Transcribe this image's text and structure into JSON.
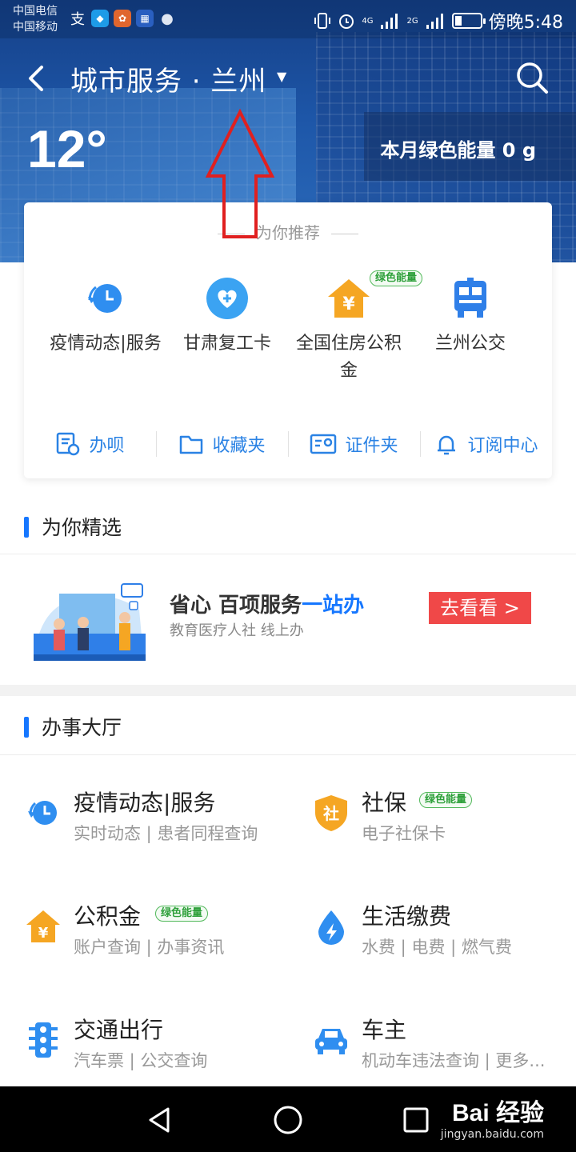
{
  "status_bar": {
    "carrier_1": "中国电信",
    "carrier_2": "中国移动",
    "network_1": "4G",
    "network_2": "2G",
    "battery_level": 0.25,
    "time": "傍晚5:48"
  },
  "header": {
    "title": "城市服务 · 兰州",
    "temperature": "12°",
    "energy_label": "本月绿色能量",
    "energy_value": "0 g"
  },
  "recommend": {
    "title": "为你推荐",
    "items": [
      {
        "label": "疫情动态|服务",
        "icon": "clock-refresh-icon"
      },
      {
        "label": "甘肃复工卡",
        "icon": "heart-plus-icon"
      },
      {
        "label": "全国住房公积金",
        "icon": "house-yuan-icon",
        "tag": "绿色能量"
      },
      {
        "label": "兰州公交",
        "icon": "bus-icon"
      }
    ],
    "shortcuts": [
      {
        "label": "办呗",
        "icon": "form-clock-icon"
      },
      {
        "label": "收藏夹",
        "icon": "folder-icon"
      },
      {
        "label": "证件夹",
        "icon": "id-card-icon"
      },
      {
        "label": "订阅中心",
        "icon": "bell-icon"
      }
    ]
  },
  "featured": {
    "title": "为你精选",
    "promo_title_a": "省心 百项服务",
    "promo_title_b": "一站办",
    "promo_sub": "教育医疗人社 线上办",
    "promo_button": "去看看 >"
  },
  "hall": {
    "title": "办事大厅",
    "services": [
      {
        "name": "疫情动态|服务",
        "desc": "实时动态 | 患者同程查询",
        "icon": "clock-refresh-icon"
      },
      {
        "name": "社保",
        "desc": "电子社保卡",
        "icon": "shield-she-icon",
        "tag": "绿色能量"
      },
      {
        "name": "公积金",
        "desc": "账户查询 | 办事资讯",
        "icon": "house-yuan-icon",
        "tag": "绿色能量"
      },
      {
        "name": "生活缴费",
        "desc": "水费 | 电费 | 燃气费",
        "icon": "bolt-drop-icon"
      },
      {
        "name": "交通出行",
        "desc": "汽车票 | 公交查询",
        "icon": "traffic-light-icon"
      },
      {
        "name": "车主",
        "desc": "机动车违法查询 | 更多...",
        "icon": "car-icon"
      }
    ]
  },
  "watermark": {
    "brand": "Bai 经验",
    "url": "jingyan.baidu.com"
  },
  "colors": {
    "accent": "#1677ff",
    "link": "#2a82e4",
    "promo_button": "#f04848",
    "green_tag": "#52b95b",
    "annotation_arrow": "#e02020"
  }
}
